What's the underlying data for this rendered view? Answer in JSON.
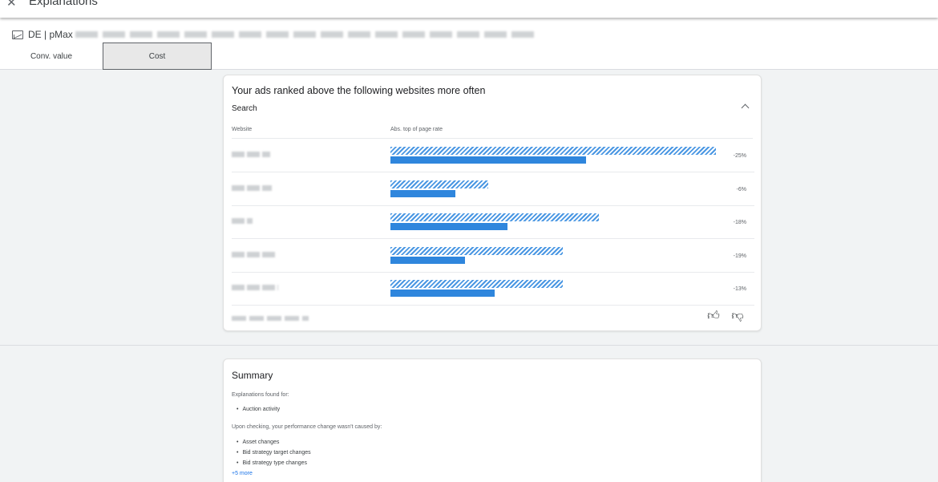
{
  "topbar": {
    "close_icon": "close-icon",
    "title": "Explanations"
  },
  "campaign": {
    "icon": "chart-icon",
    "name": "DE | pMax"
  },
  "tabs": [
    {
      "label": "Conv. value",
      "selected": false
    },
    {
      "label": "Cost",
      "selected": true
    }
  ],
  "card": {
    "title": "Your ads ranked above the following websites more often",
    "section": "Search",
    "columns": [
      "Website",
      "Abs. top of page rate"
    ],
    "chart_data": {
      "type": "bar",
      "categories": [
        "",
        "",
        "",
        "",
        ""
      ],
      "series": [
        {
          "values": [
            1.0,
            0.3,
            0.64,
            0.53,
            0.53
          ]
        },
        {
          "values": [
            0.6,
            0.2,
            0.36,
            0.23,
            0.32
          ]
        }
      ],
      "labels": [
        "-25%",
        "-6%",
        "-18%",
        "-19%",
        "-13%"
      ]
    },
    "feedback": {
      "thumbs_up_icon": "thumbs-up-icon",
      "thumbs_down_icon": "thumbs-down-icon"
    }
  },
  "summary": {
    "title": "Summary",
    "found_label": "Explanations found for:",
    "found_items": [
      "Auction activity"
    ],
    "not_caused_label": "Upon checking, your performance change wasn't caused by:",
    "not_caused_items": [
      "Asset changes",
      "Bid strategy target changes",
      "Bid strategy type changes"
    ],
    "more_link": "+5 more"
  },
  "colors": {
    "bar_hatch": "#4a97e3",
    "bar_solid": "#2f86dd",
    "link": "#1a73e8"
  }
}
